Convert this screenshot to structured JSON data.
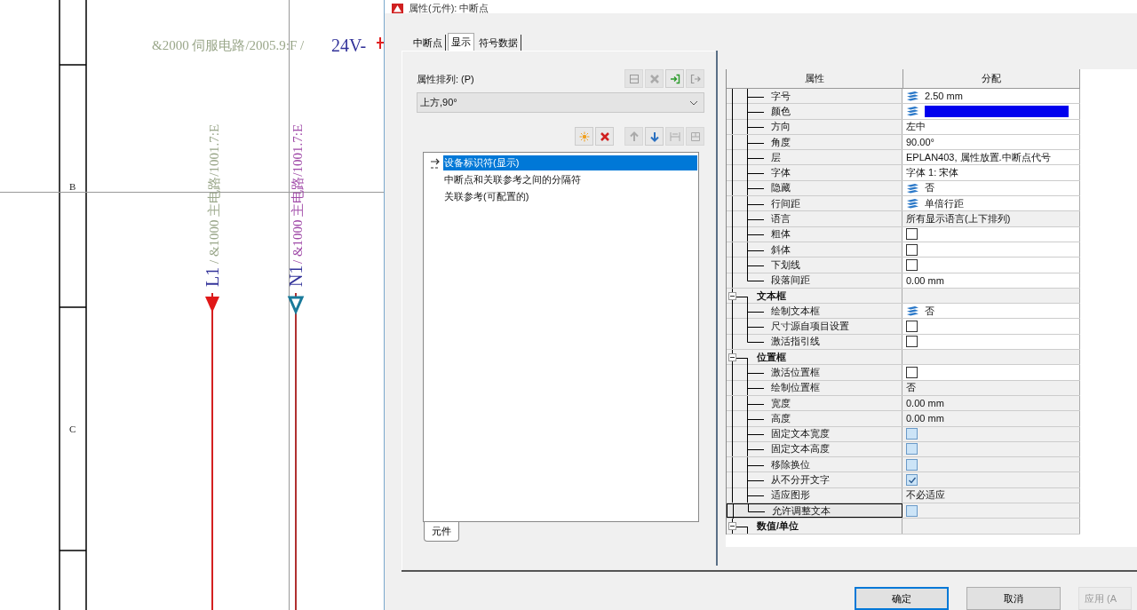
{
  "schematic": {
    "top_ref": {
      "ref": "&2000 伺服电路/2005.9:F /",
      "label": "24V-"
    },
    "row_labels": [
      "B",
      "C"
    ],
    "cross_refs": [
      {
        "label": "L1",
        "ref": "/ &1000 主电路/1001.7:E",
        "kind": "filled"
      },
      {
        "label": "N1",
        "ref": "/ &1000 主电路/1001.7:E",
        "kind": "hollow"
      }
    ]
  },
  "dialog": {
    "title": "属性(元件): 中断点",
    "tabs": [
      {
        "label": "中断点",
        "selected": false
      },
      {
        "label": "显示",
        "selected": true
      },
      {
        "label": "符号数据",
        "selected": false
      }
    ],
    "arrangement": {
      "label": "属性排列: (P)",
      "value": "上方,90°",
      "toolbar": [
        {
          "kind": "box",
          "disabled": true
        },
        {
          "kind": "cross",
          "disabled": true
        },
        {
          "kind": "arrow-in",
          "disabled": false
        },
        {
          "kind": "arrow-out",
          "disabled": true
        }
      ]
    },
    "list_toolbar": [
      {
        "kind": "star",
        "disabled": false
      },
      {
        "kind": "cross",
        "disabled": false
      },
      {
        "kind": "arrow-up",
        "disabled": true
      },
      {
        "kind": "arrow-down",
        "disabled": false
      },
      {
        "kind": "spacing",
        "disabled": true
      },
      {
        "kind": "split",
        "disabled": true
      }
    ],
    "list": [
      {
        "label": "设备标识符(显示)",
        "selected": true,
        "marker": true
      },
      {
        "label": "中断点和关联参考之间的分隔符",
        "selected": false,
        "marker": false
      },
      {
        "label": "关联参考(可配置的)",
        "selected": false,
        "marker": false
      }
    ],
    "bottom_tabs": [
      {
        "label": "元件",
        "selected": true
      }
    ],
    "grid": {
      "columns": [
        "属性",
        "分配"
      ],
      "groups": [
        {
          "children": [
            {
              "name": "字号",
              "kind": "text",
              "layer": true,
              "value": "2.50 mm",
              "readonly": false,
              "selected": false
            },
            {
              "name": "颜色",
              "kind": "color",
              "layer": true,
              "color": "#0000ee",
              "readonly": false,
              "selected": false
            },
            {
              "name": "方向",
              "kind": "text",
              "layer": false,
              "value": "左中",
              "readonly": false,
              "selected": false
            },
            {
              "name": "角度",
              "kind": "text",
              "layer": false,
              "value": "90.00°",
              "readonly": false,
              "selected": false
            },
            {
              "name": "层",
              "kind": "text",
              "layer": false,
              "value": "EPLAN403, 属性放置.中断点代号",
              "readonly": false,
              "selected": false
            },
            {
              "name": "字体",
              "kind": "text",
              "layer": false,
              "value": "字体 1: 宋体",
              "readonly": false,
              "selected": false
            },
            {
              "name": "隐藏",
              "kind": "text",
              "layer": true,
              "value": "否",
              "readonly": false,
              "selected": false
            },
            {
              "name": "行间距",
              "kind": "text",
              "layer": true,
              "value": "单倍行距",
              "readonly": false,
              "selected": false
            },
            {
              "name": "语言",
              "kind": "text",
              "layer": false,
              "value": "所有显示语言(上下排列)",
              "readonly": true,
              "selected": false
            },
            {
              "name": "粗体",
              "kind": "checkbox",
              "checked": false,
              "disabled": false,
              "readonly": false,
              "selected": false
            },
            {
              "name": "斜体",
              "kind": "checkbox",
              "checked": false,
              "disabled": false,
              "readonly": false,
              "selected": false
            },
            {
              "name": "下划线",
              "kind": "checkbox",
              "checked": false,
              "disabled": false,
              "readonly": false,
              "selected": false
            },
            {
              "name": "段落间距",
              "kind": "text",
              "layer": false,
              "value": "0.00 mm",
              "readonly": false,
              "selected": false
            }
          ]
        },
        {
          "label": "文本框",
          "expanded": true,
          "children": [
            {
              "name": "绘制文本框",
              "kind": "text",
              "layer": true,
              "value": "否",
              "readonly": false,
              "selected": false
            },
            {
              "name": "尺寸源自项目设置",
              "kind": "checkbox",
              "checked": false,
              "disabled": false,
              "readonly": false,
              "selected": false
            },
            {
              "name": "激活指引线",
              "kind": "checkbox",
              "checked": false,
              "disabled": false,
              "readonly": false,
              "selected": false
            }
          ]
        },
        {
          "label": "位置框",
          "expanded": true,
          "children": [
            {
              "name": "激活位置框",
              "kind": "checkbox",
              "checked": false,
              "disabled": false,
              "readonly": false,
              "selected": false
            },
            {
              "name": "绘制位置框",
              "kind": "text",
              "layer": false,
              "value": "否",
              "readonly": true,
              "selected": false
            },
            {
              "name": "宽度",
              "kind": "text",
              "layer": false,
              "value": "0.00 mm",
              "readonly": true,
              "selected": false
            },
            {
              "name": "高度",
              "kind": "text",
              "layer": false,
              "value": "0.00 mm",
              "readonly": true,
              "selected": false
            },
            {
              "name": "固定文本宽度",
              "kind": "checkbox",
              "checked": false,
              "disabled": true,
              "readonly": true,
              "selected": false
            },
            {
              "name": "固定文本高度",
              "kind": "checkbox",
              "checked": false,
              "disabled": true,
              "readonly": true,
              "selected": false
            },
            {
              "name": "移除换位",
              "kind": "checkbox",
              "checked": false,
              "disabled": true,
              "readonly": true,
              "selected": false
            },
            {
              "name": "从不分开文字",
              "kind": "checkbox",
              "checked": true,
              "disabled": true,
              "readonly": true,
              "selected": false
            },
            {
              "name": "适应图形",
              "kind": "text",
              "layer": false,
              "value": "不必适应",
              "readonly": true,
              "selected": false
            },
            {
              "name": "允许调整文本",
              "kind": "checkbox",
              "checked": false,
              "disabled": true,
              "readonly": true,
              "selected": true
            }
          ]
        },
        {
          "label": "数值/单位",
          "expanded": true
        }
      ]
    },
    "buttons": [
      {
        "label": "确定",
        "kind": "default",
        "disabled": false
      },
      {
        "label": "取消",
        "kind": "normal",
        "disabled": false
      },
      {
        "label": "应用 (A",
        "kind": "normal",
        "disabled": true
      }
    ]
  }
}
